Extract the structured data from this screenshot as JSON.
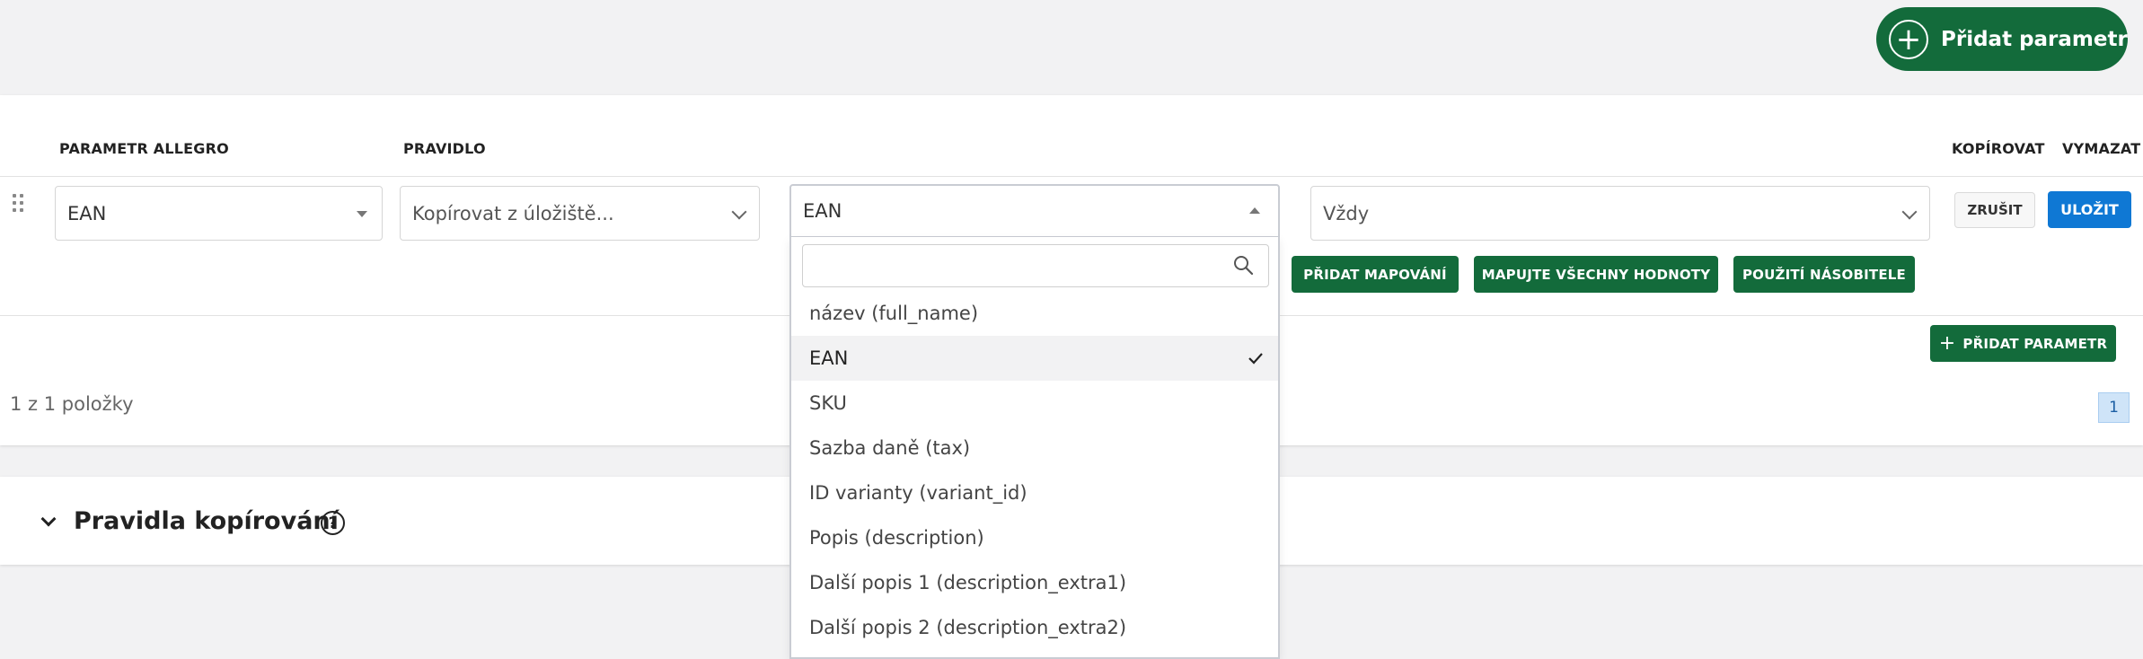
{
  "header": {
    "add_button_label": "Přidat parametr"
  },
  "table": {
    "columns": {
      "allegro_param": "PARAMETR ALLEGRO",
      "rule": "PRAVIDLO",
      "copy": "KOPÍROVAT",
      "delete": "VYMAZAT"
    },
    "row": {
      "allegro_param_value": "EAN",
      "rule_value": "Kopírovat z úložiště...",
      "source_value": "EAN",
      "condition_value": "Vždy",
      "cancel_label": "ZRUŠIT",
      "save_label": "ULOŽIT",
      "actions": [
        "PŘIDAT MAPOVÁNÍ",
        "MAPUJTE VŠECHNY HODNOTY",
        "POUŽITÍ NÁSOBITELE"
      ]
    },
    "add_param_label": "PŘIDAT PARAMETR",
    "pagination": {
      "count_text": "1 z 1 položky",
      "current_page": "1"
    }
  },
  "rules_section": {
    "title": "Pravidla kopírování",
    "help": "?"
  },
  "dropdown": {
    "search_value": "",
    "selected": "EAN",
    "options": [
      "název (full_name)",
      "EAN",
      "SKU",
      "Sazba daně (tax)",
      "ID varianty (variant_id)",
      "Popis (description)",
      "Další popis 1 (description_extra1)",
      "Další popis 2 (description_extra2)"
    ]
  },
  "colors": {
    "green": "#136b3b",
    "blue": "#0f78d4",
    "background": "#f2f2f3"
  },
  "icons": [
    "plus-circle-icon",
    "drag-handle-icon",
    "caret-down-icon",
    "caret-up-icon",
    "chevron-down-icon",
    "search-icon",
    "check-icon",
    "help-icon",
    "plus-icon"
  ]
}
